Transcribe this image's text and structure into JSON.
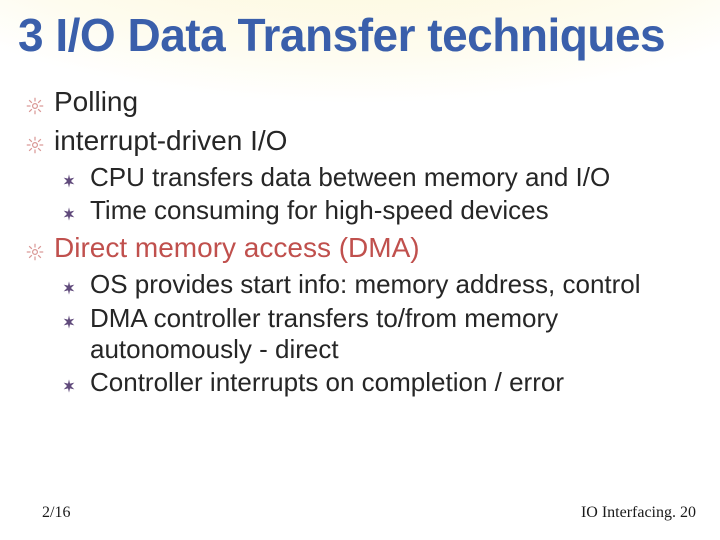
{
  "title": "3 I/O Data Transfer techniques",
  "bullets": {
    "b0": "Polling",
    "b1": " interrupt-driven I/O",
    "b1_0": "CPU transfers data between memory and I/O",
    "b1_1": "Time  consuming for high-speed devices",
    "b2": "Direct memory access (DMA)",
    "b2_0": "OS provides start info: memory address, control",
    "b2_1": "DMA controller transfers to/from memory autonomously - direct",
    "b2_2": "Controller interrupts on completion / error"
  },
  "footer": {
    "left": "2/16",
    "right": "IO Interfacing. 20"
  },
  "colors": {
    "title": "#3a5fab",
    "accent": "#c0504d",
    "bullet1_outline": "#d99694",
    "bullet2_fill": "#604a7b"
  }
}
